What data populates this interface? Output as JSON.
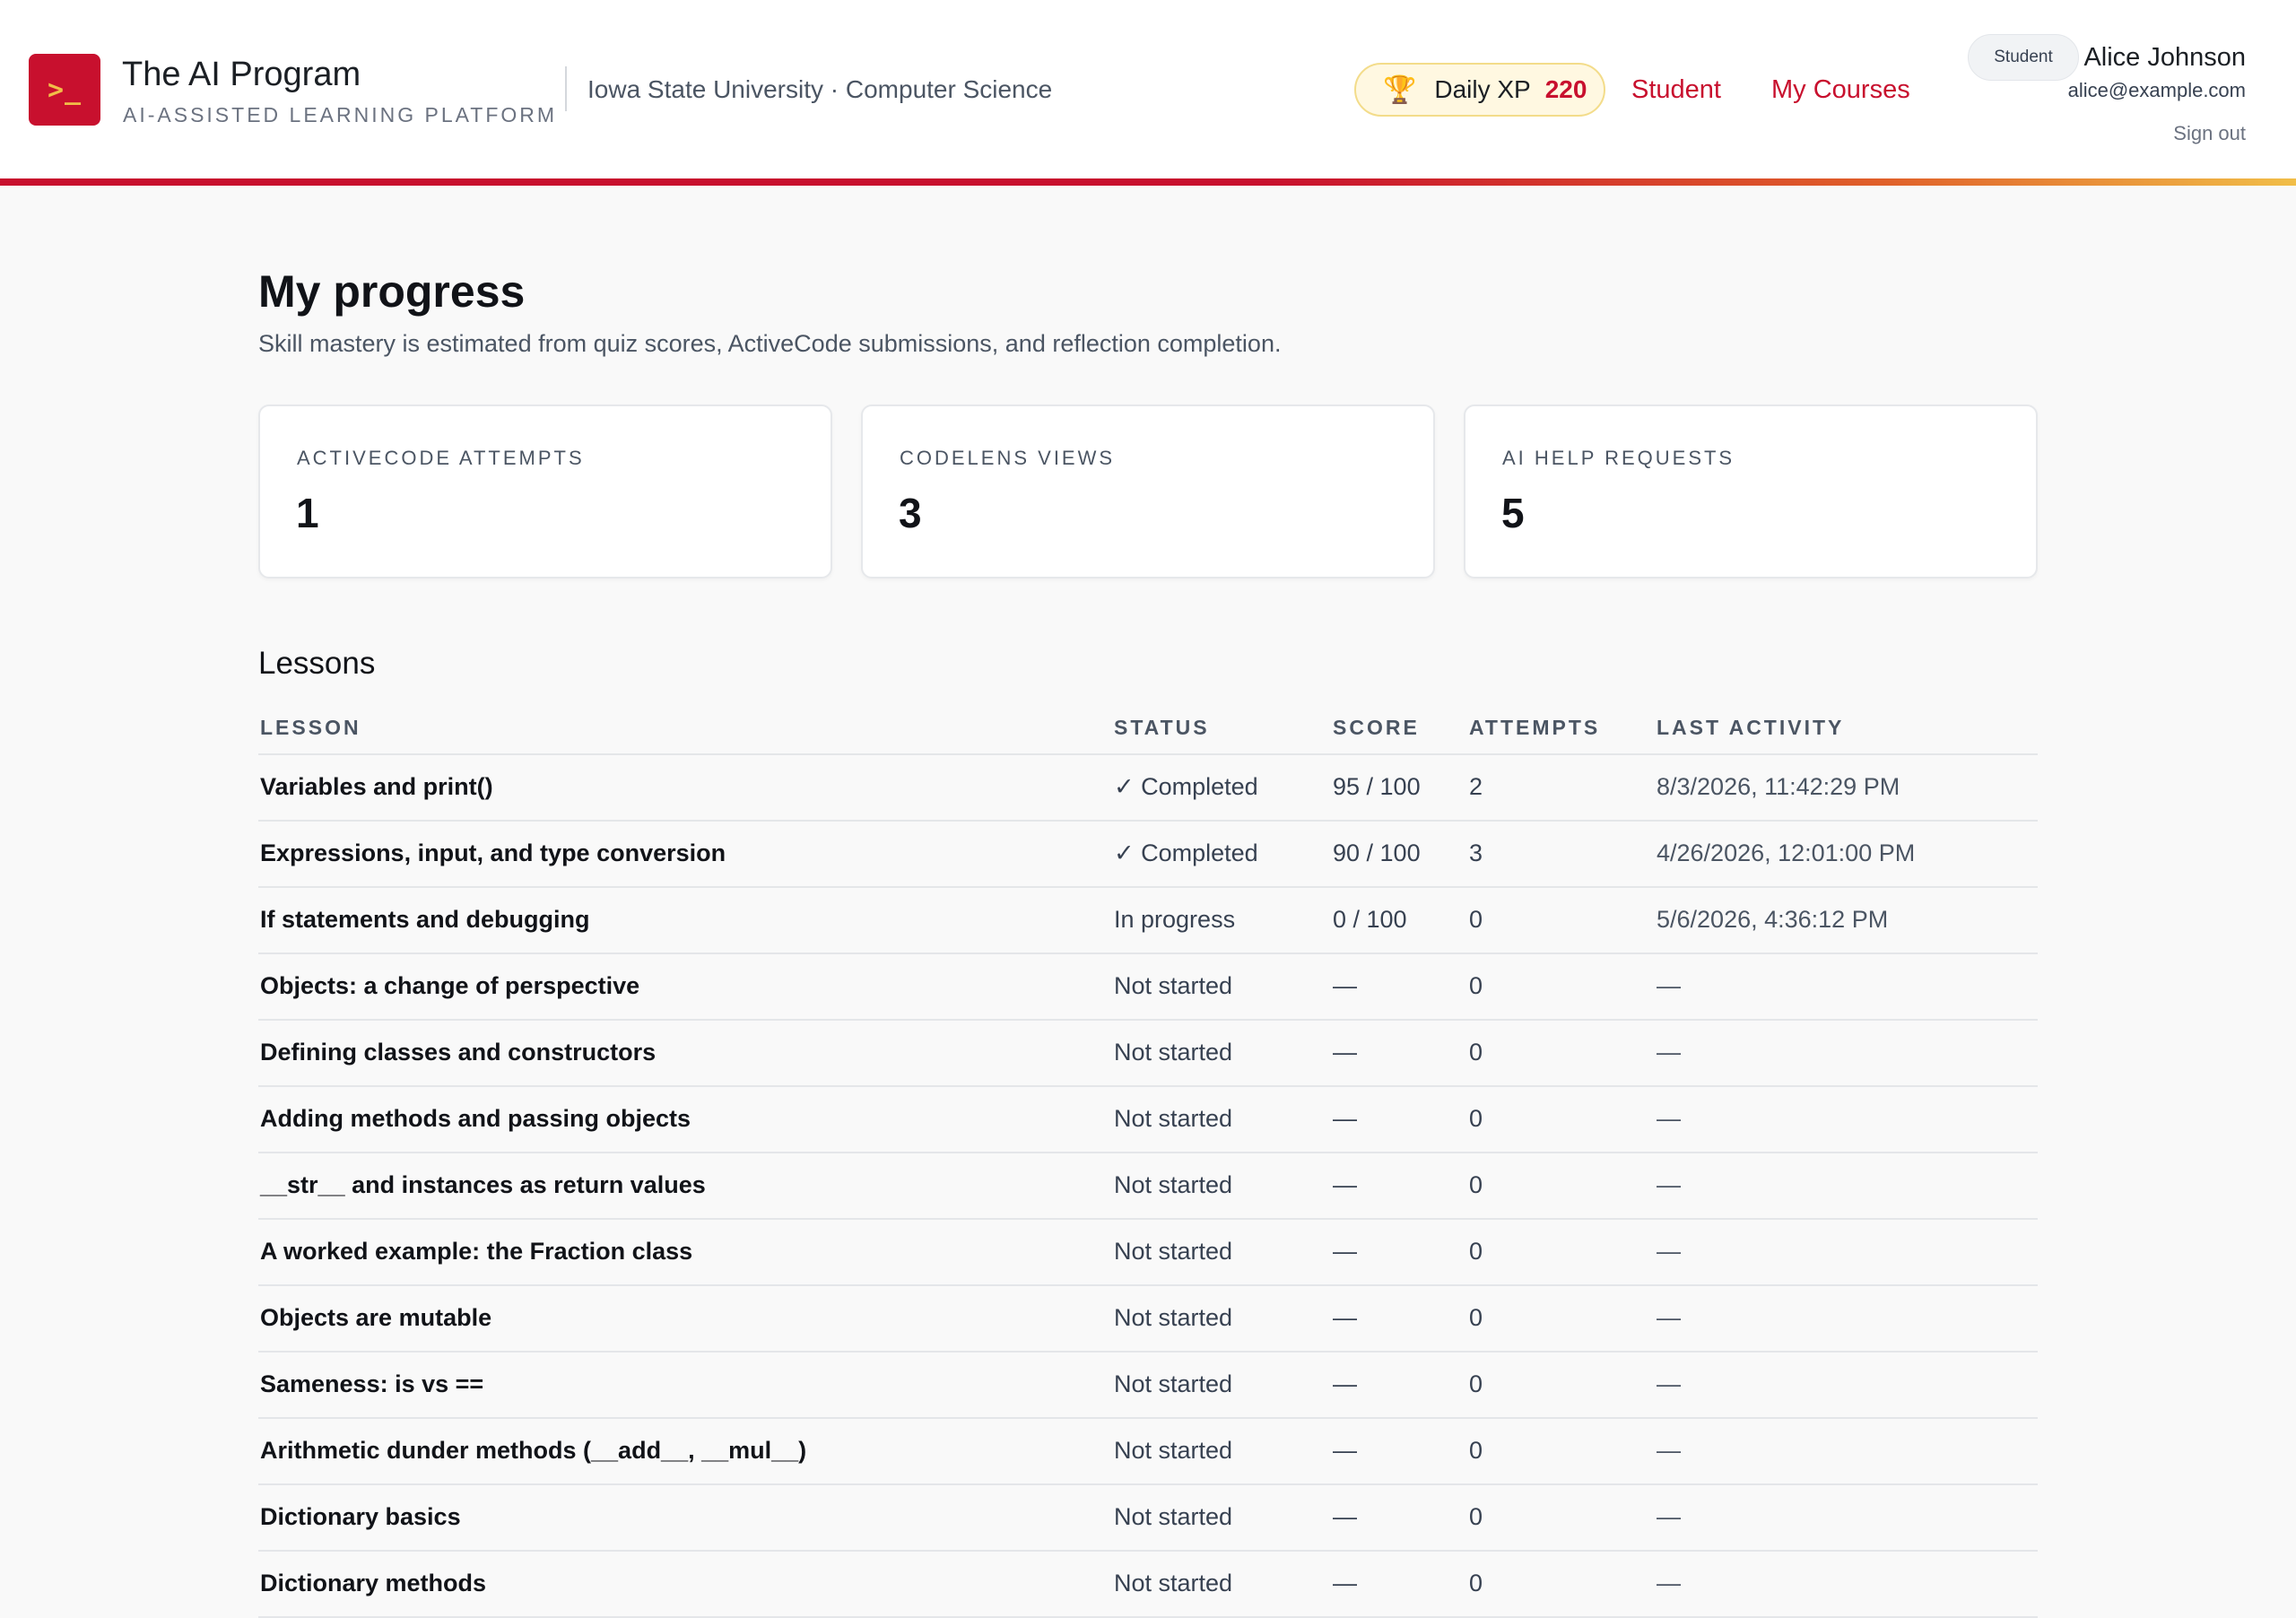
{
  "header": {
    "logo_glyph": ">_",
    "brand_title": "The AI Program",
    "brand_subtitle": "AI-ASSISTED LEARNING PLATFORM",
    "university": "Iowa State University · Computer Science",
    "xp": {
      "icon": "trophy-icon",
      "label": "Daily XP",
      "value": "220"
    },
    "nav": {
      "student": "Student",
      "courses": "My Courses"
    },
    "user": {
      "role_badge": "Student",
      "name": "Alice Johnson",
      "email": "alice@example.com",
      "sign_out": "Sign out"
    }
  },
  "page": {
    "title": "My progress",
    "subtitle": "Skill mastery is estimated from quiz scores, ActiveCode submissions, and reflection completion."
  },
  "stats": [
    {
      "label": "ACTIVECODE ATTEMPTS",
      "value": "1"
    },
    {
      "label": "CODELENS VIEWS",
      "value": "3"
    },
    {
      "label": "AI HELP REQUESTS",
      "value": "5"
    }
  ],
  "lessons": {
    "title": "Lessons",
    "columns": {
      "lesson": "LESSON",
      "status": "STATUS",
      "score": "SCORE",
      "attempts": "ATTEMPTS",
      "last": "LAST ACTIVITY"
    },
    "rows": [
      {
        "lesson": "Variables and print()",
        "status": "✓ Completed",
        "score": "95 / 100",
        "attempts": "2",
        "last": "8/3/2026, 11:42:29 PM"
      },
      {
        "lesson": "Expressions, input, and type conversion",
        "status": "✓ Completed",
        "score": "90 / 100",
        "attempts": "3",
        "last": "4/26/2026, 12:01:00 PM"
      },
      {
        "lesson": "If statements and debugging",
        "status": "In progress",
        "score": "0 / 100",
        "attempts": "0",
        "last": "5/6/2026, 4:36:12 PM"
      },
      {
        "lesson": "Objects: a change of perspective",
        "status": "Not started",
        "score": "—",
        "attempts": "0",
        "last": "—"
      },
      {
        "lesson": "Defining classes and constructors",
        "status": "Not started",
        "score": "—",
        "attempts": "0",
        "last": "—"
      },
      {
        "lesson": "Adding methods and passing objects",
        "status": "Not started",
        "score": "—",
        "attempts": "0",
        "last": "—"
      },
      {
        "lesson": "__str__ and instances as return values",
        "status": "Not started",
        "score": "—",
        "attempts": "0",
        "last": "—"
      },
      {
        "lesson": "A worked example: the Fraction class",
        "status": "Not started",
        "score": "—",
        "attempts": "0",
        "last": "—"
      },
      {
        "lesson": "Objects are mutable",
        "status": "Not started",
        "score": "—",
        "attempts": "0",
        "last": "—"
      },
      {
        "lesson": "Sameness: is vs ==",
        "status": "Not started",
        "score": "—",
        "attempts": "0",
        "last": "—"
      },
      {
        "lesson": "Arithmetic dunder methods (__add__, __mul__)",
        "status": "Not started",
        "score": "—",
        "attempts": "0",
        "last": "—"
      },
      {
        "lesson": "Dictionary basics",
        "status": "Not started",
        "score": "—",
        "attempts": "0",
        "last": "—"
      },
      {
        "lesson": "Dictionary methods",
        "status": "Not started",
        "score": "—",
        "attempts": "0",
        "last": "—"
      }
    ]
  }
}
